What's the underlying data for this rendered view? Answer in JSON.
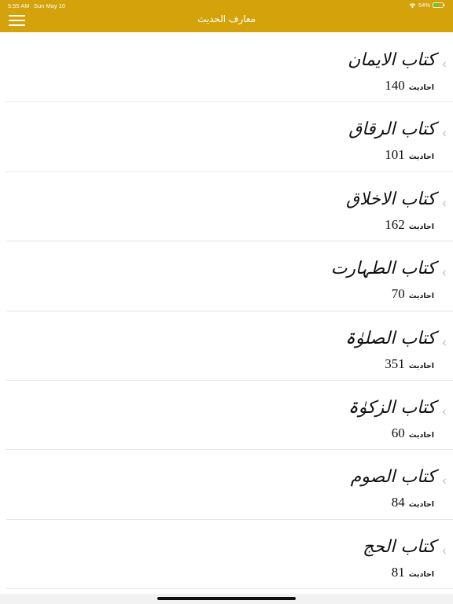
{
  "status_bar": {
    "time": "5:55 AM",
    "date": "Sun May 10",
    "battery": "54%"
  },
  "nav": {
    "title": "معارف الحدیث"
  },
  "colors": {
    "accent": "#D4A20A",
    "divider": "#e6e6e6",
    "text": "#111111"
  },
  "list": {
    "items": [
      {
        "title": "کتاب الایمان",
        "count": "140",
        "unit": "احادیث"
      },
      {
        "title": "کتاب الرقاق",
        "count": "101",
        "unit": "احادیث"
      },
      {
        "title": "کتاب الاخلاق",
        "count": "162",
        "unit": "احادیث"
      },
      {
        "title": "کتاب الطہارت",
        "count": "70",
        "unit": "احادیث"
      },
      {
        "title": "کتاب الصلوٰۃ",
        "count": "351",
        "unit": "احادیث"
      },
      {
        "title": "کتاب الزکوٰۃ",
        "count": "60",
        "unit": "احادیث"
      },
      {
        "title": "کتاب الصوم",
        "count": "84",
        "unit": "احادیث"
      },
      {
        "title": "کتاب الحج",
        "count": "81",
        "unit": "احادیث"
      }
    ]
  },
  "icons": {
    "menu": "hamburger-icon",
    "wifi": "wifi-icon",
    "battery": "battery-icon",
    "chevron": "chevron-left-icon"
  }
}
